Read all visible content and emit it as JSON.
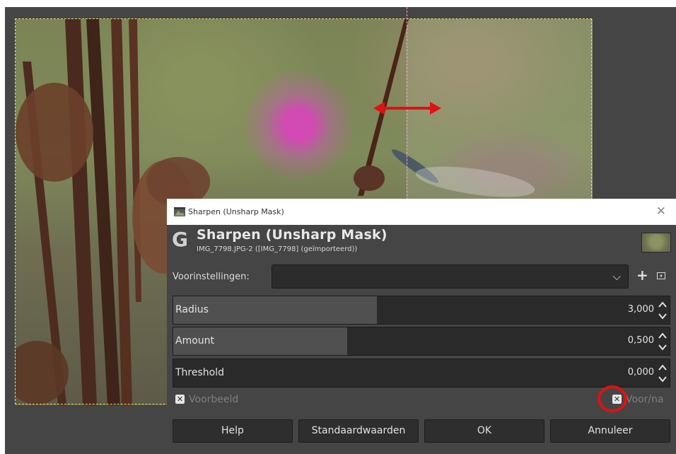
{
  "dialog": {
    "window_title": "Sharpen (Unsharp Mask)",
    "heading": "Sharpen (Unsharp Mask)",
    "subheading": "IMG_7798.JPG-2 ([IMG_7798] (geïmporteerd))",
    "presets_label": "Voorinstellingen:",
    "presets_value": "",
    "sliders": [
      {
        "label": "Radius",
        "value": "3,000",
        "fill_fraction": 0.41
      },
      {
        "label": "Amount",
        "value": "0,500",
        "fill_fraction": 0.35
      },
      {
        "label": "Threshold",
        "value": "0,000",
        "fill_fraction": 0.0
      }
    ],
    "preview_label": "Voorbeeld",
    "split_label": "Voor/na",
    "buttons": {
      "help": "Help",
      "reset": "Standaardwaarden",
      "ok": "OK",
      "cancel": "Annuleer"
    }
  },
  "annotation_color": "#e01212"
}
